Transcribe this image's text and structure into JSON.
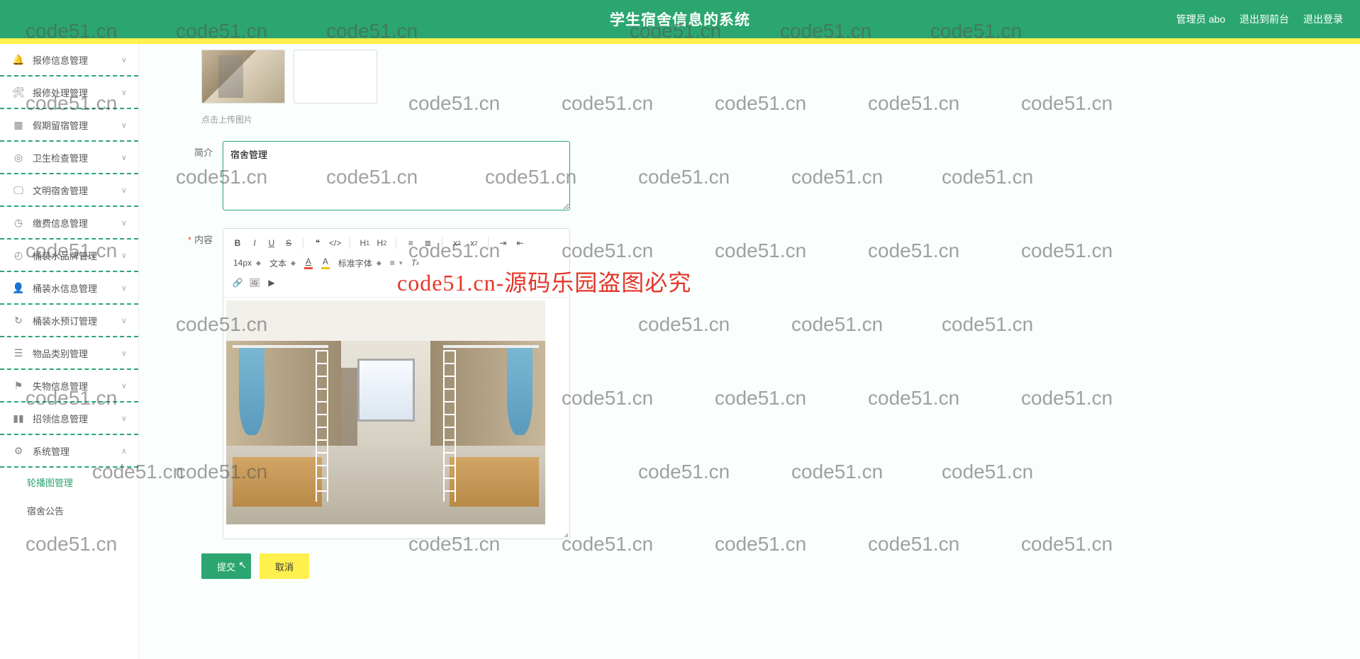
{
  "header": {
    "title": "学生宿舍信息的系统",
    "admin_label": "管理员 abo",
    "to_front": "退出到前台",
    "logout": "退出登录"
  },
  "sidebar": {
    "items": [
      {
        "label": "报修信息管理",
        "chevron": "∨"
      },
      {
        "label": "报修处理管理",
        "chevron": "∨"
      },
      {
        "label": "假期留宿管理",
        "chevron": "∨"
      },
      {
        "label": "卫生检查管理",
        "chevron": "∨"
      },
      {
        "label": "文明宿舍管理",
        "chevron": "∨"
      },
      {
        "label": "缴费信息管理",
        "chevron": "∨"
      },
      {
        "label": "桶装水品牌管理",
        "chevron": "∨"
      },
      {
        "label": "桶装水信息管理",
        "chevron": "∨"
      },
      {
        "label": "桶装水预订管理",
        "chevron": "∨"
      },
      {
        "label": "物品类别管理",
        "chevron": "∨"
      },
      {
        "label": "失物信息管理",
        "chevron": "∨"
      },
      {
        "label": "招领信息管理",
        "chevron": "∨"
      },
      {
        "label": "系统管理",
        "chevron": "∧"
      }
    ],
    "sub_items": [
      {
        "label": "轮播图管理",
        "active": true
      },
      {
        "label": "宿舍公告",
        "active": false
      }
    ]
  },
  "form": {
    "upload_hint": "点击上传图片",
    "brief_label": "简介",
    "brief_value": "宿舍管理",
    "content_label": "内容",
    "required_mark": "*"
  },
  "editor": {
    "font_size": "14px",
    "para_format": "文本",
    "font_family": "标准字体"
  },
  "buttons": {
    "submit": "提交",
    "cancel": "取消"
  },
  "watermark": {
    "text": "code51.cn",
    "red_text": "code51.cn-源码乐园盗图必究"
  }
}
